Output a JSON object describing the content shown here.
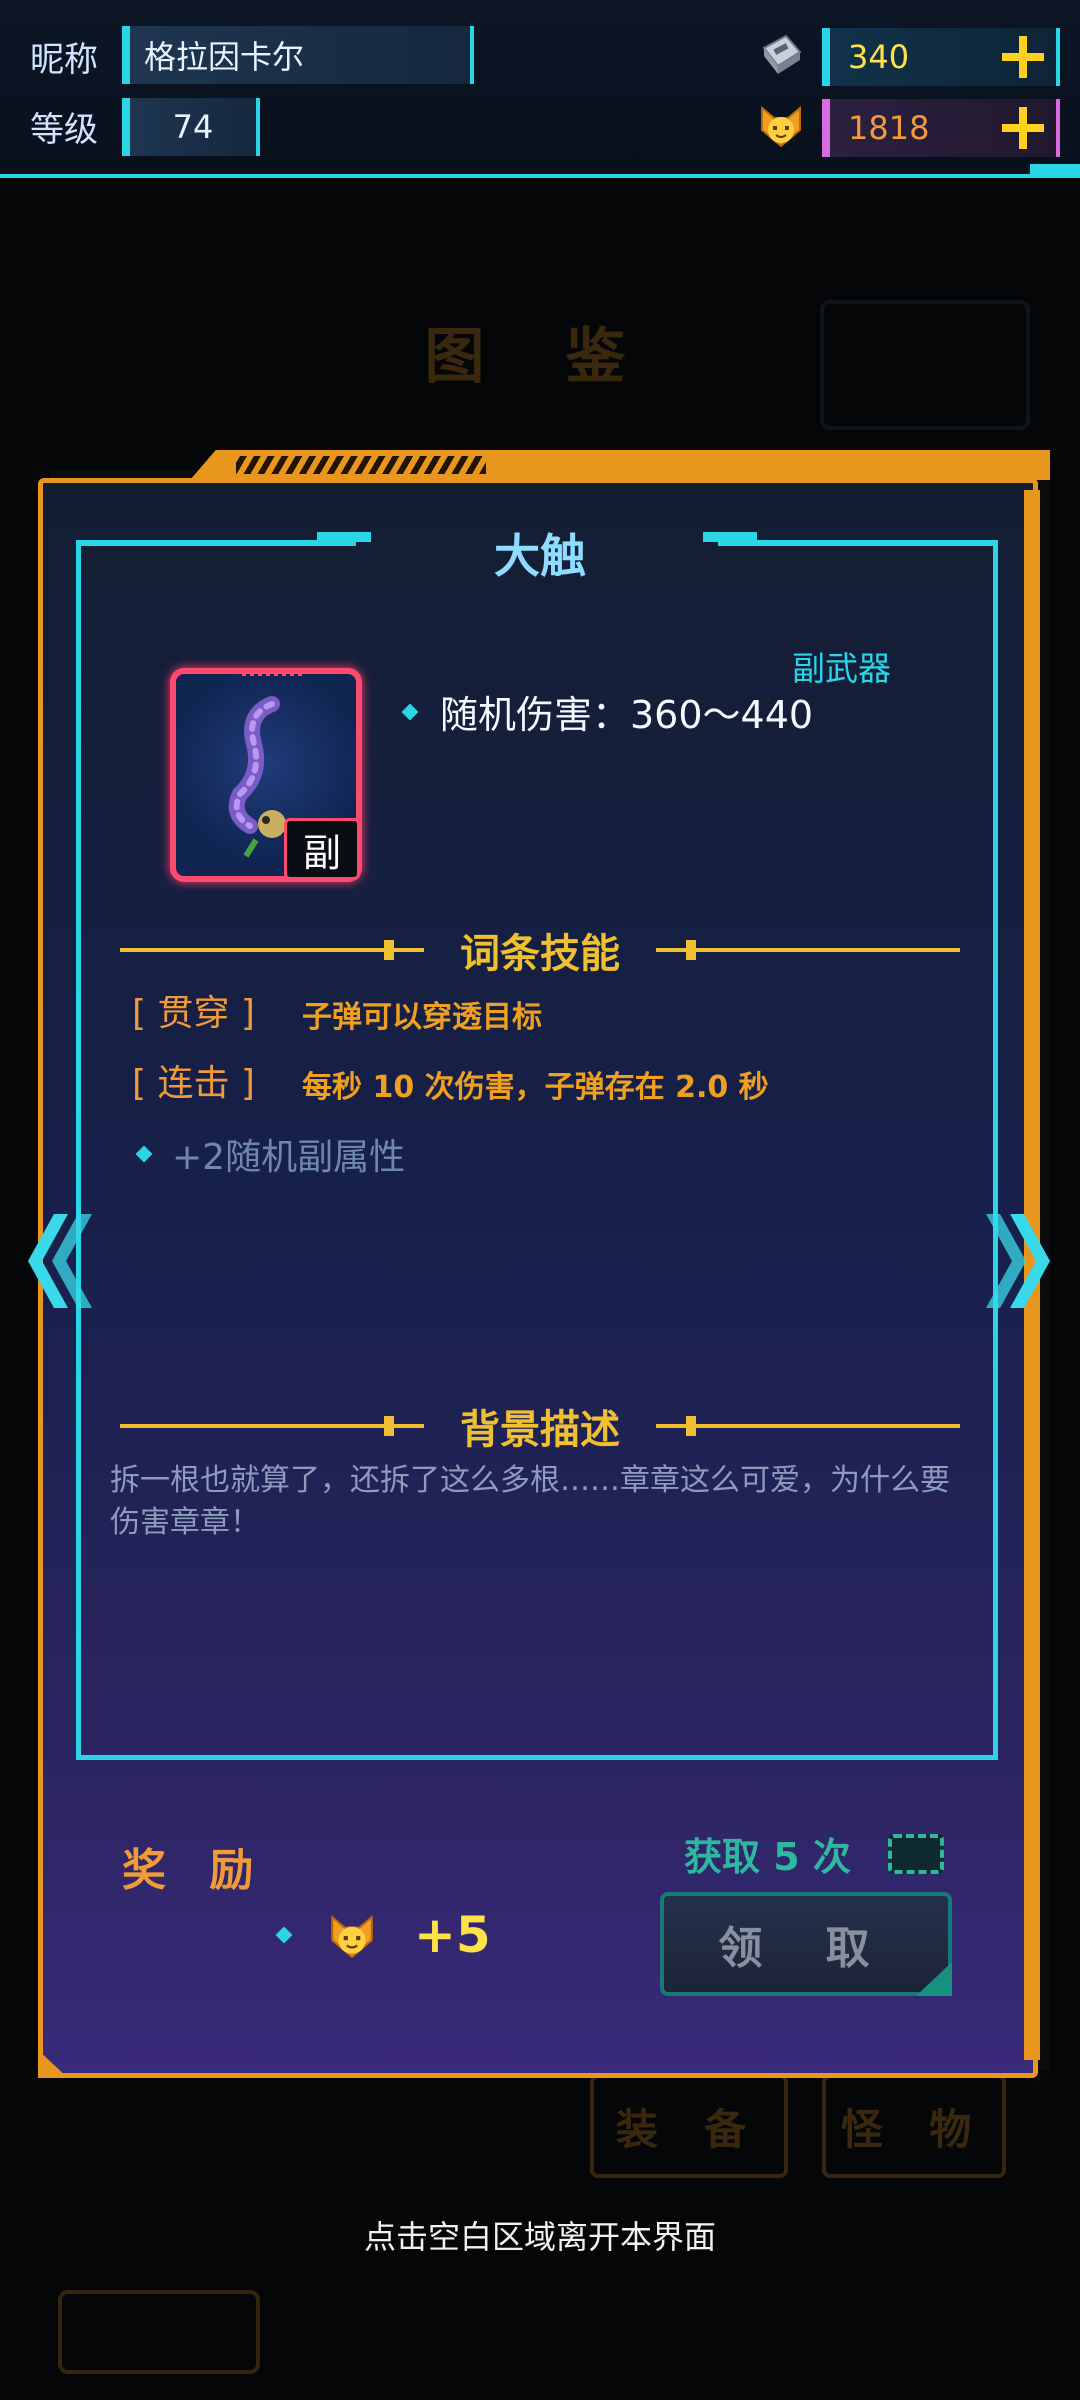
{
  "header": {
    "nickname_label": "昵称",
    "nickname_value": "格拉因卡尔",
    "level_label": "等级",
    "level_value": "74",
    "gems": "340",
    "coins": "1818",
    "gem_icon": "crystal-pack-icon",
    "coin_icon": "cat-coin-icon"
  },
  "background": {
    "title": "图 鉴",
    "tabs": [
      "装 备",
      "怪 物"
    ]
  },
  "item": {
    "name": "大触",
    "type": "副武器",
    "badge": "副",
    "stat": "随机伤害：360～440"
  },
  "skills": {
    "title": "词条技能",
    "entries": [
      {
        "name": "[ 贯穿 ]",
        "desc": "子弹可以穿透目标"
      },
      {
        "name": "[ 连击 ]",
        "desc": "每秒 10 次伤害，子弹存在 2.0 秒"
      }
    ],
    "extra": "+2随机副属性"
  },
  "description": {
    "title": "背景描述",
    "text": "拆一根也就算了，还拆了这么多根……章章这么可爱，为什么要伤害章章！"
  },
  "reward": {
    "label": "奖 励",
    "amount": "+5",
    "obtain": "获取 5 次",
    "claim": "领 取"
  },
  "footer": {
    "hint": "点击空白区域离开本界面"
  },
  "colors": {
    "accent_cyan": "#2ad6e6",
    "frame_orange": "#e8961e",
    "gold": "#f0c030",
    "card_pink": "#ff4a70"
  }
}
